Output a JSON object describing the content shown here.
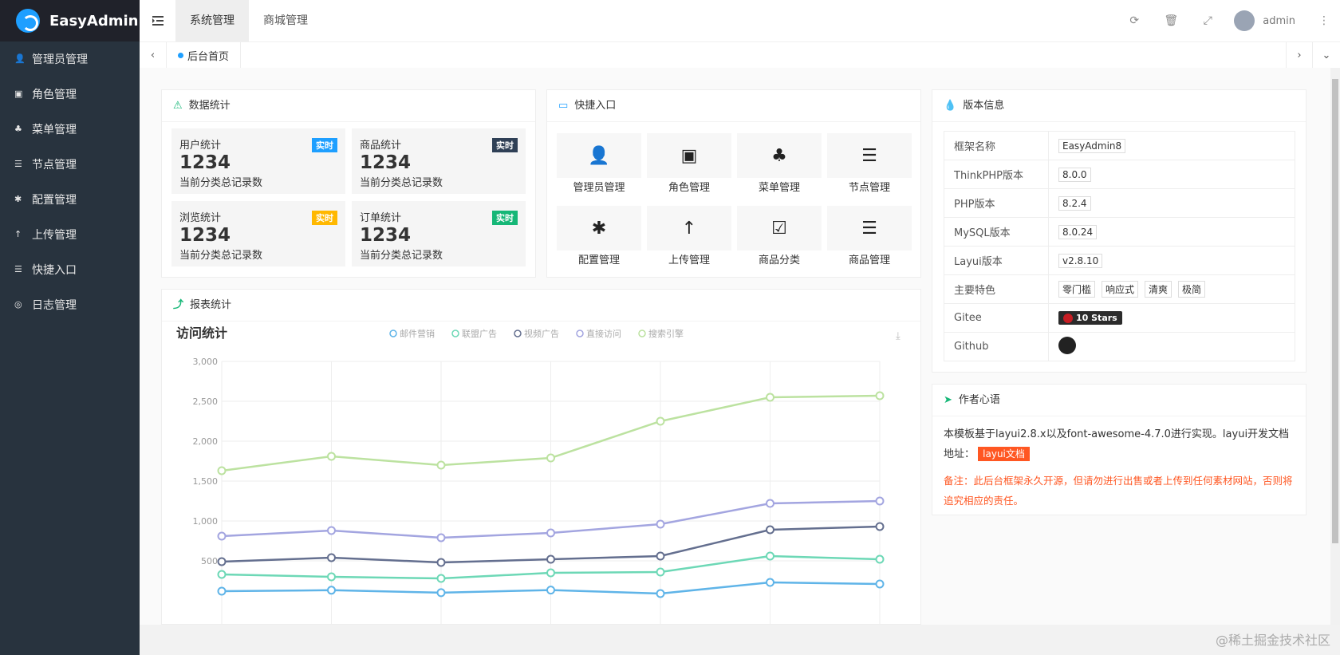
{
  "app": {
    "title": "EasyAdmin"
  },
  "sidebar": {
    "items": [
      {
        "label": "管理员管理",
        "icon": "user-icon"
      },
      {
        "label": "角色管理",
        "icon": "role-icon"
      },
      {
        "label": "菜单管理",
        "icon": "tree-icon"
      },
      {
        "label": "节点管理",
        "icon": "list-icon"
      },
      {
        "label": "配置管理",
        "icon": "asterisk-icon"
      },
      {
        "label": "上传管理",
        "icon": "upload-icon"
      },
      {
        "label": "快捷入口",
        "icon": "list-icon"
      },
      {
        "label": "日志管理",
        "icon": "log-icon"
      }
    ]
  },
  "header": {
    "tabs": [
      "系统管理",
      "商城管理"
    ],
    "user": "admin"
  },
  "tabbar": {
    "home": "后台首页"
  },
  "stats": {
    "title": "数据统计",
    "items": [
      {
        "label": "用户统计",
        "badge": "实时",
        "color": "#1e9fff",
        "value": "1234",
        "sub": "当前分类总记录数"
      },
      {
        "label": "商品统计",
        "badge": "实时",
        "color": "#2f4056",
        "value": "1234",
        "sub": "当前分类总记录数"
      },
      {
        "label": "浏览统计",
        "badge": "实时",
        "color": "#ffb800",
        "value": "1234",
        "sub": "当前分类总记录数"
      },
      {
        "label": "订单统计",
        "badge": "实时",
        "color": "#16b777",
        "value": "1234",
        "sub": "当前分类总记录数"
      }
    ]
  },
  "quick": {
    "title": "快捷入口",
    "items": [
      {
        "label": "管理员管理",
        "icon": "user-icon"
      },
      {
        "label": "角色管理",
        "icon": "role-icon"
      },
      {
        "label": "菜单管理",
        "icon": "tree-icon"
      },
      {
        "label": "节点管理",
        "icon": "list-icon"
      },
      {
        "label": "配置管理",
        "icon": "asterisk-icon"
      },
      {
        "label": "上传管理",
        "icon": "upload-icon"
      },
      {
        "label": "商品分类",
        "icon": "calendar-check-icon"
      },
      {
        "label": "商品管理",
        "icon": "list-icon"
      }
    ]
  },
  "report": {
    "title": "报表统计"
  },
  "version": {
    "title": "版本信息",
    "rows": [
      {
        "k": "框架名称",
        "v": "EasyAdmin8"
      },
      {
        "k": "ThinkPHP版本",
        "v": "8.0.0"
      },
      {
        "k": "PHP版本",
        "v": "8.2.4"
      },
      {
        "k": "MySQL版本",
        "v": "8.0.24"
      },
      {
        "k": "Layui版本",
        "v": "v2.8.10"
      }
    ],
    "features_label": "主要特色",
    "features": [
      "零门槛",
      "响应式",
      "清爽",
      "极简"
    ],
    "gitee_label": "Gitee",
    "gitee_badge": "10 Stars",
    "github_label": "Github"
  },
  "author": {
    "title": "作者心语",
    "text1": "本模板基于layui2.8.x以及font-awesome-4.7.0进行实现。layui开发文档地址：",
    "link": "layui文档",
    "note": "备注：此后台框架永久开源，但请勿进行出售或者上传到任何素材网站，否则将追究相应的责任。"
  },
  "watermark": "@稀土掘金技术社区",
  "chart_data": {
    "type": "line",
    "title": "访问统计",
    "x": [
      "",
      "",
      "",
      "",
      "",
      "",
      ""
    ],
    "ylim": [
      0,
      3000
    ],
    "yticks": [
      "500",
      "1,000",
      "1,500",
      "2,000",
      "2,500",
      "3,000"
    ],
    "legend_position": "top",
    "series": [
      {
        "name": "邮件营销",
        "color": "#5fb4e8",
        "values": [
          120,
          132,
          101,
          134,
          90,
          230,
          210
        ]
      },
      {
        "name": "联盟广告",
        "color": "#6dd8b6",
        "values": [
          330,
          300,
          280,
          350,
          360,
          560,
          520
        ]
      },
      {
        "name": "视频广告",
        "color": "#646f8f",
        "values": [
          490,
          540,
          480,
          520,
          560,
          890,
          930
        ]
      },
      {
        "name": "直接访问",
        "color": "#a3a5e0",
        "values": [
          810,
          880,
          790,
          850,
          960,
          1220,
          1250
        ]
      },
      {
        "name": "搜索引擎",
        "color": "#bce2a0",
        "values": [
          1630,
          1810,
          1700,
          1790,
          2250,
          2550,
          2570
        ]
      }
    ]
  }
}
